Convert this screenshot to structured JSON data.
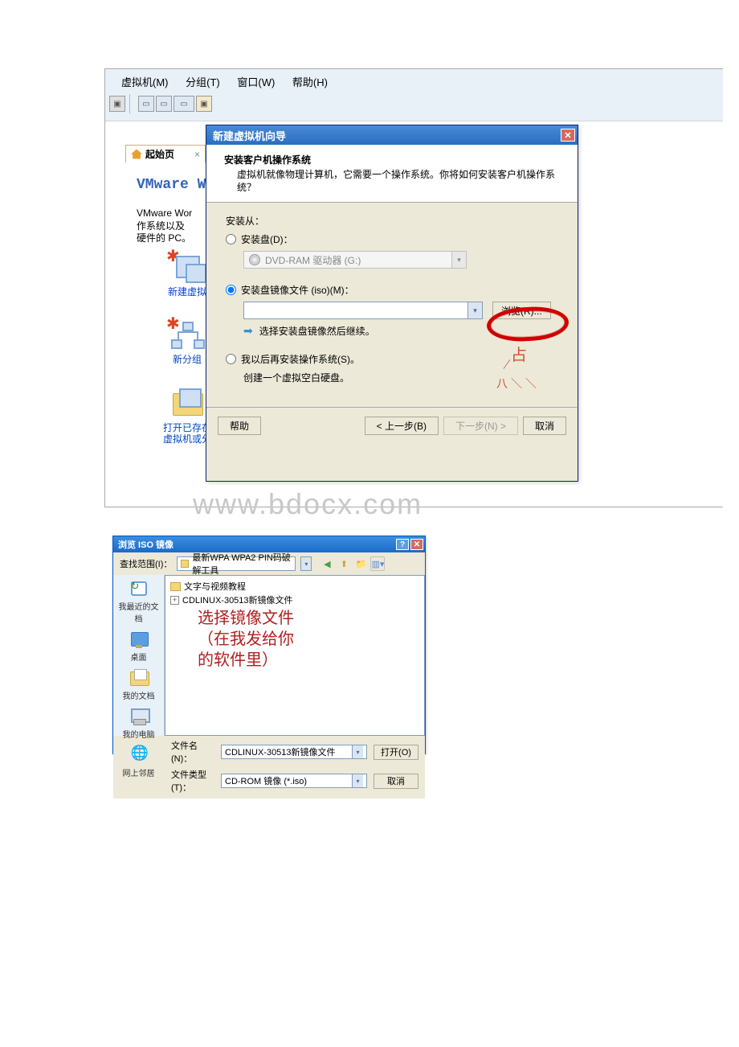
{
  "watermark": "www.bdocx.com",
  "menubar": {
    "vm": "虚拟机(M)",
    "group": "分组(T)",
    "window": "窗口(W)",
    "help": "帮助(H)"
  },
  "home_tab": {
    "label": "起始页",
    "close": "×"
  },
  "vmware_title": "VMware W",
  "vmware_desc": "VMware Wor\n作系统以及\n硬件的 PC。",
  "side": {
    "new_vm": "新建虚拟",
    "new_group": "新分组",
    "open_existing": "打开已存在\n虚拟机或分"
  },
  "wizard": {
    "title": "新建虚拟机向导",
    "head_title": "安装客户机操作系统",
    "head_desc": "虚拟机就像物理计算机，它需要一个操作系统。你将如何安装客户机操作系统？",
    "install_from": "安装从：",
    "opt_disk": "安装盘(D)：",
    "disk_sel": "DVD-RAM 驱动器 (G:)",
    "opt_iso": "安装盘镜像文件 (iso)(M)：",
    "browse": "浏览(R)...",
    "hint": "选择安装盘镜像然后继续。",
    "opt_later": "我以后再安装操作系统(S)。",
    "opt_later_sub": "创建一个虚拟空白硬盘。",
    "help": "帮助",
    "back": "< 上一步(B)",
    "next": "下一步(N) >",
    "cancel": "取消"
  },
  "dlg2": {
    "title": "浏览 ISO 镜像",
    "look_in_lbl": "查找范围(I)：",
    "look_in": "最新WPA WPA2 PIN码破解工具",
    "files": {
      "f1": "文字与视频教程",
      "f2": "CDLINUX-30513新镜像文件"
    },
    "annotation": "选择镜像文件\n（在我发给你\n的软件里）",
    "places": {
      "recent": "我最近的文档",
      "desktop": "桌面",
      "docs": "我的文档",
      "computer": "我的电脑",
      "network": "网上邻居"
    },
    "filename_lbl": "文件名(N)：",
    "filename": "CDLINUX-30513新镜像文件",
    "filetype_lbl": "文件类型(T)：",
    "filetype": "CD-ROM 镜像 (*.iso)",
    "open": "打开(O)",
    "cancel": "取消"
  }
}
